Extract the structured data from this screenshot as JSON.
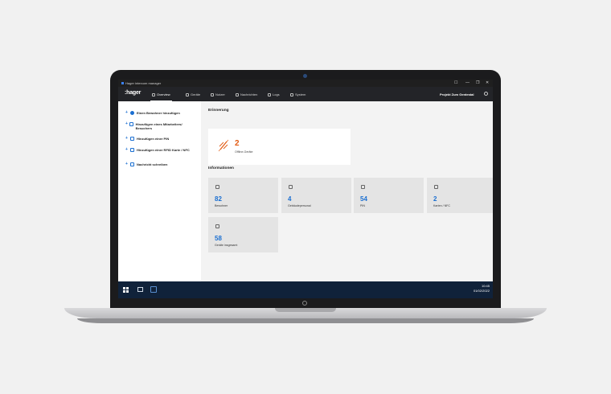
{
  "titlebar": {
    "title": "Hager intercom manager",
    "controls": [
      "☐",
      "—",
      "❐",
      "✕"
    ]
  },
  "topnav": {
    "logo": ":hager",
    "items": [
      {
        "label": "Overview",
        "icon": "home-icon",
        "active": true
      },
      {
        "label": "Geräte",
        "icon": "device-icon"
      },
      {
        "label": "Nutzer",
        "icon": "users-icon"
      },
      {
        "label": "Nachrichten",
        "icon": "message-icon"
      },
      {
        "label": "Logs",
        "icon": "log-icon"
      },
      {
        "label": "System",
        "icon": "system-icon"
      }
    ],
    "project": "Projekt Zum Gentestal"
  },
  "sidebar": {
    "items": [
      {
        "label": "Einen Bewohner hinzufügen",
        "icon": "user-icon"
      },
      {
        "label": "Hinzufügen eines Mitarbeiters/ Besuchers",
        "icon": "users-icon"
      },
      {
        "label": "Hinzufügen einer PIN",
        "icon": "pin-icon"
      },
      {
        "label": "Hinzufügen einer RFID Karte / NFC",
        "icon": "card-icon"
      },
      {
        "label": "Nachricht schreiben",
        "icon": "message-icon"
      }
    ]
  },
  "main": {
    "reminder_title": "Erinnerung",
    "reminder": {
      "value": "2",
      "label": "Offline-Geräte",
      "color": "#e25b13"
    },
    "info_title": "Informationen",
    "cards": [
      {
        "value": "82",
        "label": "Bewohner",
        "icon": "user-icon"
      },
      {
        "value": "4",
        "label": "Gebäudepersonal",
        "icon": "staff-icon"
      },
      {
        "value": "54",
        "label": "PIN",
        "icon": "pin-icon"
      },
      {
        "value": "2",
        "label": "Karten / NFC",
        "icon": "card-icon"
      },
      {
        "value": "58",
        "label": "Geräte insgesamt",
        "icon": "device-icon"
      }
    ]
  },
  "taskbar": {
    "time": "10:45",
    "date": "01/02/2022"
  },
  "accent": "#1b6fd1"
}
